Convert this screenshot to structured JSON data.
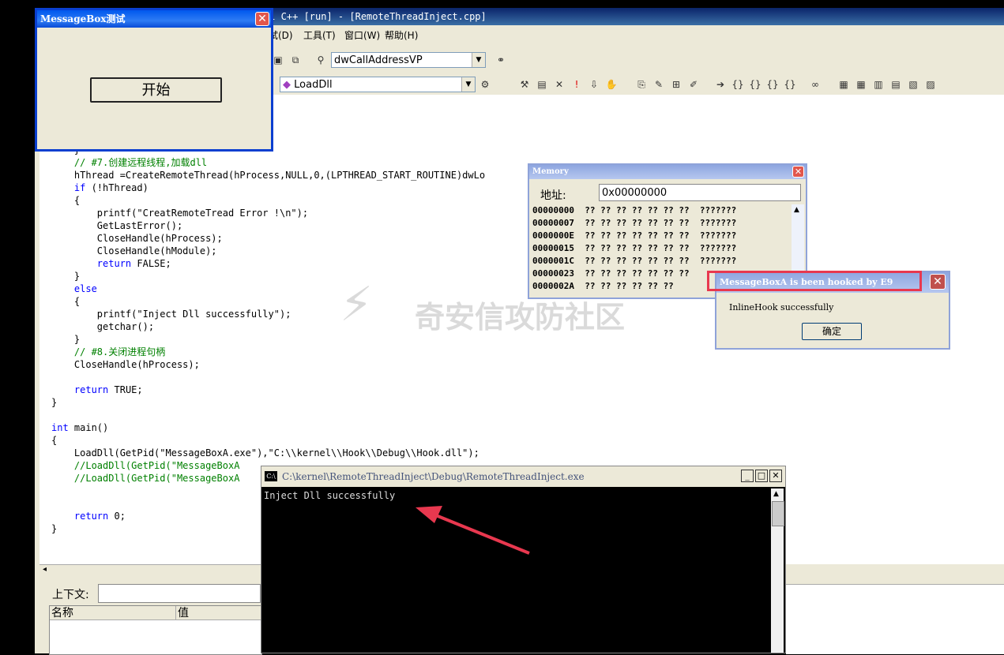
{
  "ide": {
    "title": "al C++ [run] - [RemoteThreadInject.cpp]",
    "menu": [
      "试(D)",
      "工具(T)",
      "窗口(W)",
      "帮助(H)"
    ],
    "combo_function": "dwCallAddressVP",
    "combo_member": "LoadDll"
  },
  "code_lines": [
    {
      "text": "    }",
      "cls": ""
    },
    {
      "text": "    // #7.创建远程线程,加载dll",
      "cls": "cm"
    },
    {
      "text": "    hThread =CreateRemoteThread(hProcess,NULL,0,(LPTHREAD_START_ROUTINE)dwLo",
      "cls": ""
    },
    {
      "text": "    if (!hThread)",
      "cls": "kwline"
    },
    {
      "text": "    {",
      "cls": ""
    },
    {
      "text": "        printf(\"CreatRemoteTread Error !\\n\");",
      "cls": ""
    },
    {
      "text": "        GetLastError();",
      "cls": ""
    },
    {
      "text": "        CloseHandle(hProcess);",
      "cls": ""
    },
    {
      "text": "        CloseHandle(hModule);",
      "cls": ""
    },
    {
      "text": "        return FALSE;",
      "cls": "kwline"
    },
    {
      "text": "    }",
      "cls": ""
    },
    {
      "text": "    else",
      "cls": "kw"
    },
    {
      "text": "    {",
      "cls": ""
    },
    {
      "text": "        printf(\"Inject Dll successfully\");",
      "cls": ""
    },
    {
      "text": "        getchar();",
      "cls": ""
    },
    {
      "text": "    }",
      "cls": ""
    },
    {
      "text": "    // #8.关闭进程句柄",
      "cls": "cm"
    },
    {
      "text": "    CloseHandle(hProcess);",
      "cls": ""
    },
    {
      "text": "",
      "cls": ""
    },
    {
      "text": "    return TRUE;",
      "cls": "kwline"
    },
    {
      "text": "}",
      "cls": ""
    },
    {
      "text": "",
      "cls": ""
    },
    {
      "text": "int main()",
      "cls": "kwline"
    },
    {
      "text": "{",
      "cls": ""
    },
    {
      "text": "    LoadDll(GetPid(\"MessageBoxA.exe\"),\"C:\\\\kernel\\\\Hook\\\\Debug\\\\Hook.dll\");",
      "cls": ""
    },
    {
      "text": "    //LoadDll(GetPid(\"MessageBoxA",
      "cls": "cm"
    },
    {
      "text": "    //LoadDll(GetPid(\"MessageBoxA",
      "cls": "cm"
    },
    {
      "text": "",
      "cls": ""
    },
    {
      "text": "",
      "cls": ""
    },
    {
      "text": "    return 0;",
      "cls": "kwline"
    },
    {
      "text": "}",
      "cls": ""
    }
  ],
  "msgbox_test": {
    "title": "MessageBox测试",
    "button": "开始"
  },
  "memory": {
    "title": "Memory",
    "address_label": "地址:",
    "address_value": "0x00000000",
    "rows": [
      "00000000  ?? ?? ?? ?? ?? ?? ??  ???????",
      "00000007  ?? ?? ?? ?? ?? ?? ??  ???????",
      "0000000E  ?? ?? ?? ?? ?? ?? ??  ???????",
      "00000015  ?? ?? ?? ?? ?? ?? ??  ???????",
      "0000001C  ?? ?? ?? ?? ?? ?? ??  ???????",
      "00000023  ?? ?? ?? ?? ?? ?? ??",
      "0000002A  ?? ?? ?? ?? ?? ??"
    ]
  },
  "hooked_box": {
    "title": "MessageBoxA is been hooked by E9",
    "message": "InlineHook successfully",
    "ok": "确定"
  },
  "console": {
    "title": "C:\\kernel\\RemoteThreadInject\\Debug\\RemoteThreadInject.exe",
    "output": "Inject Dll successfully"
  },
  "bottom": {
    "context_label": "上下文:",
    "col_name": "名称",
    "col_value": "值"
  },
  "watermark": "奇安信攻防社区",
  "colors": {
    "accent_red": "#e8384f",
    "titlebar_blue": "#0058ee"
  }
}
